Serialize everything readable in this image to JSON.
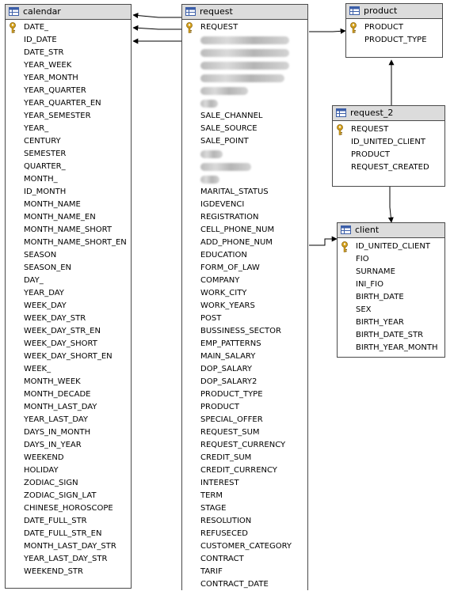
{
  "tables": {
    "calendar": {
      "title": "calendar",
      "columns": [
        "DATE_",
        "ID_DATE",
        "DATE_STR",
        "YEAR_WEEK",
        "YEAR_MONTH",
        "YEAR_QUARTER",
        "YEAR_QUARTER_EN",
        "YEAR_SEMESTER",
        "YEAR_",
        "CENTURY",
        "SEMESTER",
        "QUARTER_",
        "MONTH_",
        "ID_MONTH",
        "MONTH_NAME",
        "MONTH_NAME_EN",
        "MONTH_NAME_SHORT",
        "MONTH_NAME_SHORT_EN",
        "SEASON",
        "SEASON_EN",
        "DAY_",
        "YEAR_DAY",
        "WEEK_DAY",
        "WEEK_DAY_STR",
        "WEEK_DAY_STR_EN",
        "WEEK_DAY_SHORT",
        "WEEK_DAY_SHORT_EN",
        "WEEK_",
        "MONTH_WEEK",
        "MONTH_DECADE",
        "MONTH_LAST_DAY",
        "YEAR_LAST_DAY",
        "DAYS_IN_MONTH",
        "DAYS_IN_YEAR",
        "WEEKEND",
        "HOLIDAY",
        "ZODIAC_SIGN",
        "ZODIAC_SIGN_LAT",
        "CHINESE_HOROSCOPE",
        "DATE_FULL_STR",
        "DATE_FULL_STR_EN",
        "MONTH_LAST_DAY_STR",
        "YEAR_LAST_DAY_STR",
        "WEEKEND_STR"
      ],
      "key_columns": [
        "DATE_"
      ]
    },
    "request": {
      "title": "request",
      "columns": [
        "REQUEST",
        "",
        "",
        "",
        "",
        "",
        "",
        "SALE_CHANNEL",
        "SALE_SOURCE",
        "SALE_POINT",
        "",
        "",
        "",
        "MARITAL_STATUS",
        "IGDEVENCI",
        "REGISTRATION",
        "CELL_PHONE_NUM",
        "ADD_PHONE_NUM",
        "EDUCATION",
        "FORM_OF_LAW",
        "COMPANY",
        "WORK_CITY",
        "WORK_YEARS",
        "POST",
        "BUSSINESS_SECTOR",
        "EMP_PATTERNS",
        "MAIN_SALARY",
        "DOP_SALARY",
        "DOP_SALARY2",
        "PRODUCT_TYPE",
        "PRODUCT",
        "SPECIAL_OFFER",
        "REQUEST_SUM",
        "REQUEST_CURRENCY",
        "CREDIT_SUM",
        "CREDIT_CURRENCY",
        "INTEREST",
        "TERM",
        "STAGE",
        "RESOLUTION",
        "REFUSECED",
        "CUSTOMER_CATEGORY",
        "CONTRACT",
        "TARIF",
        "CONTRACT_DATE"
      ],
      "key_columns": [
        "REQUEST"
      ]
    },
    "product": {
      "title": "product",
      "columns": [
        "PRODUCT",
        "PRODUCT_TYPE"
      ],
      "key_columns": [
        "PRODUCT"
      ]
    },
    "request_2": {
      "title": "request_2",
      "columns": [
        "REQUEST",
        "ID_UNITED_CLIENT",
        "PRODUCT",
        "REQUEST_CREATED"
      ],
      "key_columns": [
        "REQUEST"
      ]
    },
    "client": {
      "title": "client",
      "columns": [
        "ID_UNITED_CLIENT",
        "FIO",
        "SURNAME",
        "INI_FIO",
        "BIRTH_DATE",
        "SEX",
        "BIRTH_YEAR",
        "BIRTH_DATE_STR",
        "BIRTH_YEAR_MONTH"
      ],
      "key_columns": [
        "ID_UNITED_CLIENT"
      ]
    }
  },
  "colors": {
    "header_bg": "#dcdcdc",
    "border": "#4a4a4a",
    "key_gold": "#d6a21c",
    "table_icon_blue": "#3b5ea8"
  }
}
